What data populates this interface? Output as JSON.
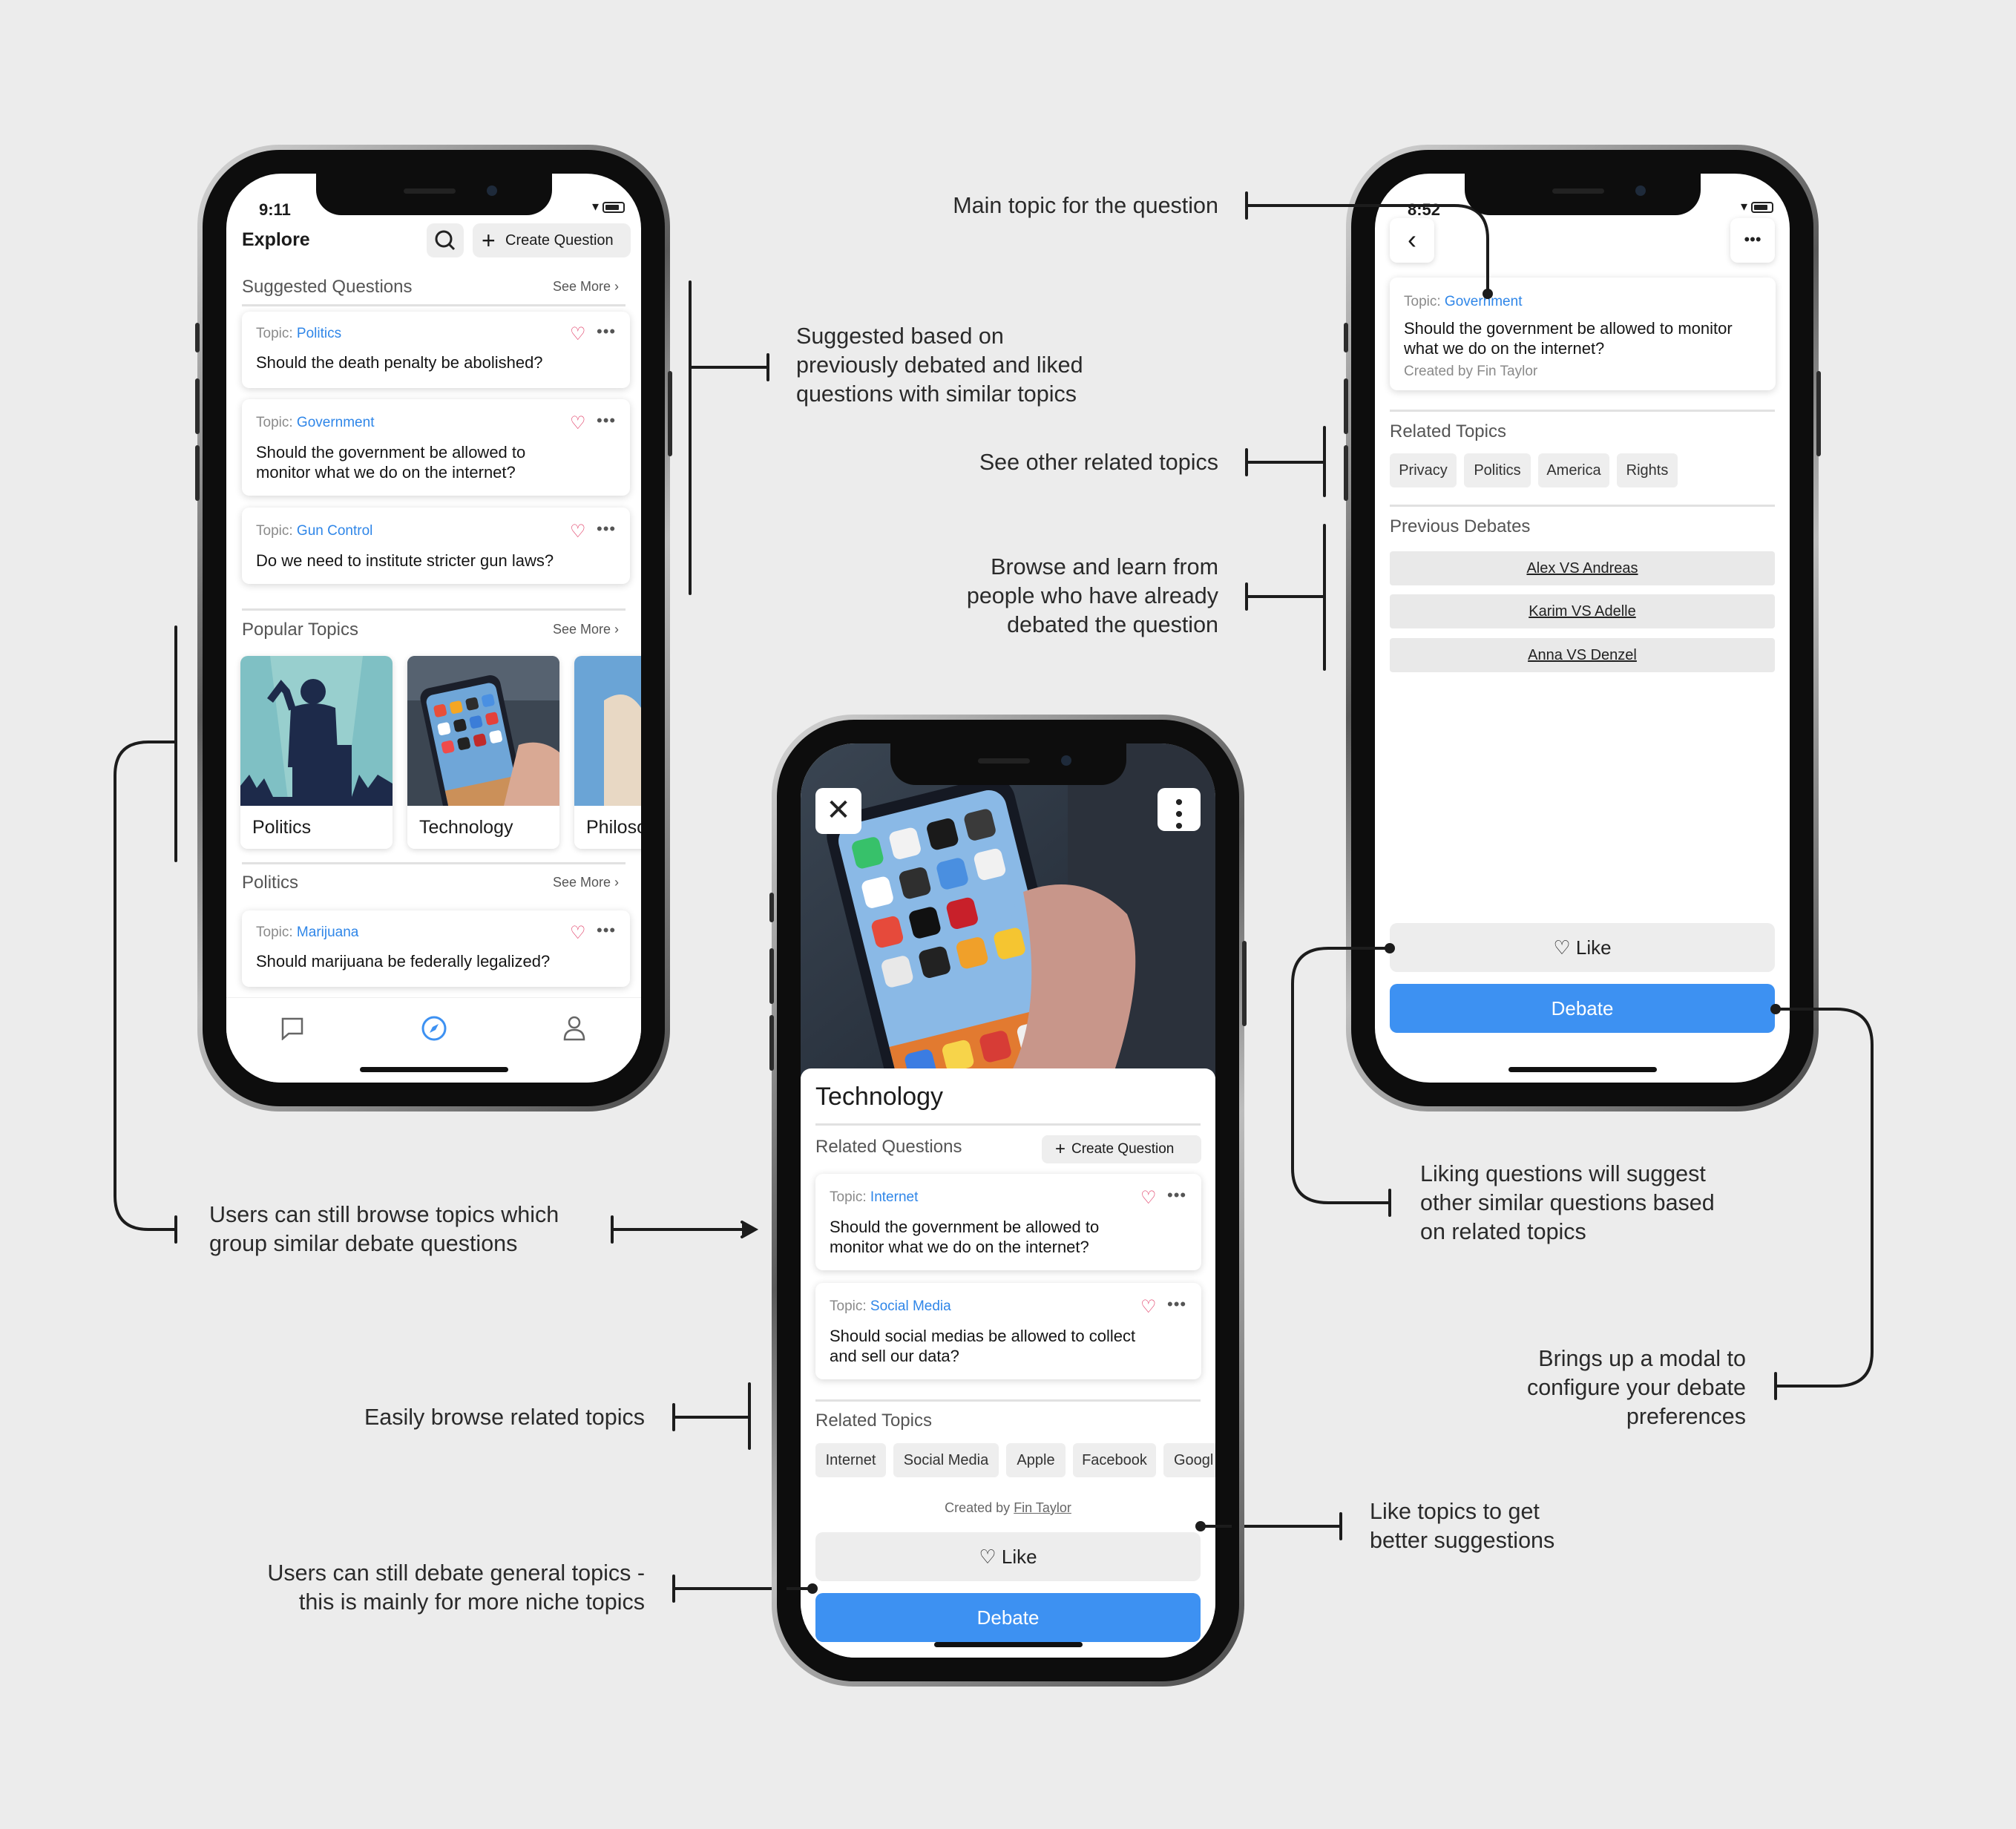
{
  "annotations": {
    "suggested": "Suggested based on\npreviously debated and liked\nquestions with similar topics",
    "browse_topics": "Users can still browse topics which\ngroup similar debate questions",
    "related_topics_easily": "Easily browse related topics",
    "debate_general": "Users can still debate general topics -\nthis is mainly for more niche topics",
    "like_topics": "Like topics to get\nbetter suggestions",
    "main_topic": "Main topic for the question",
    "see_related": "See other related topics",
    "browse_learn": "Browse and learn from\npeople who have already\ndebated the question",
    "liking_questions": "Liking questions will suggest\nother similar questions based\non related topics",
    "modal": "Brings up a modal to\nconfigure your debate\npreferences"
  },
  "explore": {
    "time": "9:11",
    "title": "Explore",
    "search_icon": "search-icon",
    "create_label": "Create Question",
    "suggested_title": "Suggested Questions",
    "see_more": "See More",
    "suggested": [
      {
        "topic_prefix": "Topic:",
        "topic": "Politics",
        "question": "Should the death penalty be abolished?"
      },
      {
        "topic_prefix": "Topic:",
        "topic": "Government",
        "question": "Should the government be allowed to\nmonitor what we do on the internet?"
      },
      {
        "topic_prefix": "Topic:",
        "topic": "Gun Control",
        "question": "Do we need to institute stricter gun laws?"
      }
    ],
    "popular_title": "Popular Topics",
    "popular": [
      "Politics",
      "Technology",
      "Philoso"
    ],
    "politics_title": "Politics",
    "politics_questions": [
      {
        "topic_prefix": "Topic:",
        "topic": "Marijuana",
        "question": "Should marijuana be federally legalized?"
      }
    ],
    "tabs": [
      "chat-icon",
      "compass-icon",
      "profile-icon"
    ]
  },
  "technology": {
    "title": "Technology",
    "related_questions_title": "Related Questions",
    "create_label": "Create Question",
    "questions": [
      {
        "topic_prefix": "Topic:",
        "topic": "Internet",
        "question": "Should the government be allowed to\nmonitor what we do on the internet?"
      },
      {
        "topic_prefix": "Topic:",
        "topic": "Social Media",
        "question": "Should social medias be allowed to collect\nand sell our data?"
      }
    ],
    "related_topics_title": "Related Topics",
    "related_topics": [
      "Internet",
      "Social Media",
      "Apple",
      "Facebook",
      "Googl"
    ],
    "created_by_prefix": "Created by",
    "created_by": "Fin Taylor",
    "like_label": "Like",
    "debate_label": "Debate"
  },
  "question_detail": {
    "time": "8:52",
    "topic_prefix": "Topic:",
    "topic": "Government",
    "question": "Should the government be allowed to monitor\nwhat we do on the internet?",
    "created_by": "Created by Fin Taylor",
    "related_topics_title": "Related Topics",
    "related_topics": [
      "Privacy",
      "Politics",
      "America",
      "Rights"
    ],
    "previous_debates_title": "Previous Debates",
    "previous_debates": [
      "Alex VS Andreas",
      "Karim VS Adelle",
      "Anna VS Denzel"
    ],
    "like_label": "Like",
    "debate_label": "Debate"
  },
  "colors": {
    "accent": "#3d91f2",
    "topic_link": "#2f86e8",
    "heart": "#e03a64",
    "background": "#ececec"
  }
}
